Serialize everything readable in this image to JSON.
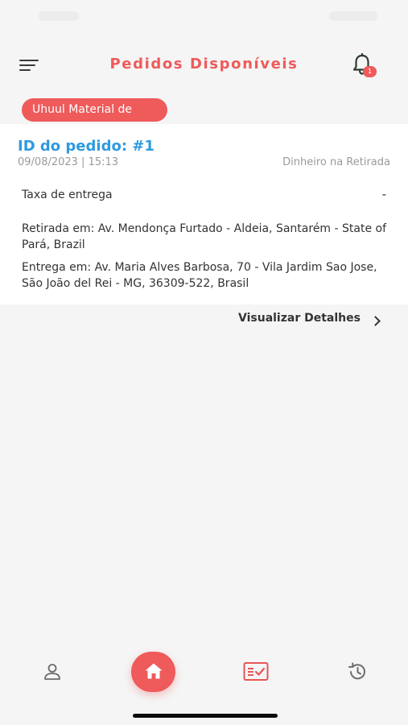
{
  "header": {
    "title": "Pedidos Disponíveis",
    "notification_count": "1"
  },
  "store": {
    "name": "Uhuul Material de"
  },
  "order": {
    "id_label": "ID do pedido: #1",
    "datetime": "09/08/2023 | 15:13",
    "payment_method": "Dinheiro na Retirada",
    "fee_label": "Taxa de entrega",
    "fee_value": "-",
    "pickup": "Retirada em: Av. Mendonça Furtado - Aldeia, Santarém - State of Pará, Brazil",
    "delivery": "Entrega em: Av. Maria Alves Barbosa, 70 - Vila Jardim Sao Jose, São João del Rei - MG, 36309-522, Brasil",
    "details_link": "Visualizar Detalhes"
  },
  "bottom_nav": {
    "items": [
      {
        "icon": "user-icon",
        "active": false
      },
      {
        "icon": "home-icon",
        "active": true
      },
      {
        "icon": "orders-checklist-icon",
        "active": false
      },
      {
        "icon": "history-icon",
        "active": false
      }
    ]
  },
  "colors": {
    "accent": "#ef5a5a",
    "order_id": "#2f9adf",
    "background": "#f5f5f5",
    "card": "#ffffff"
  }
}
